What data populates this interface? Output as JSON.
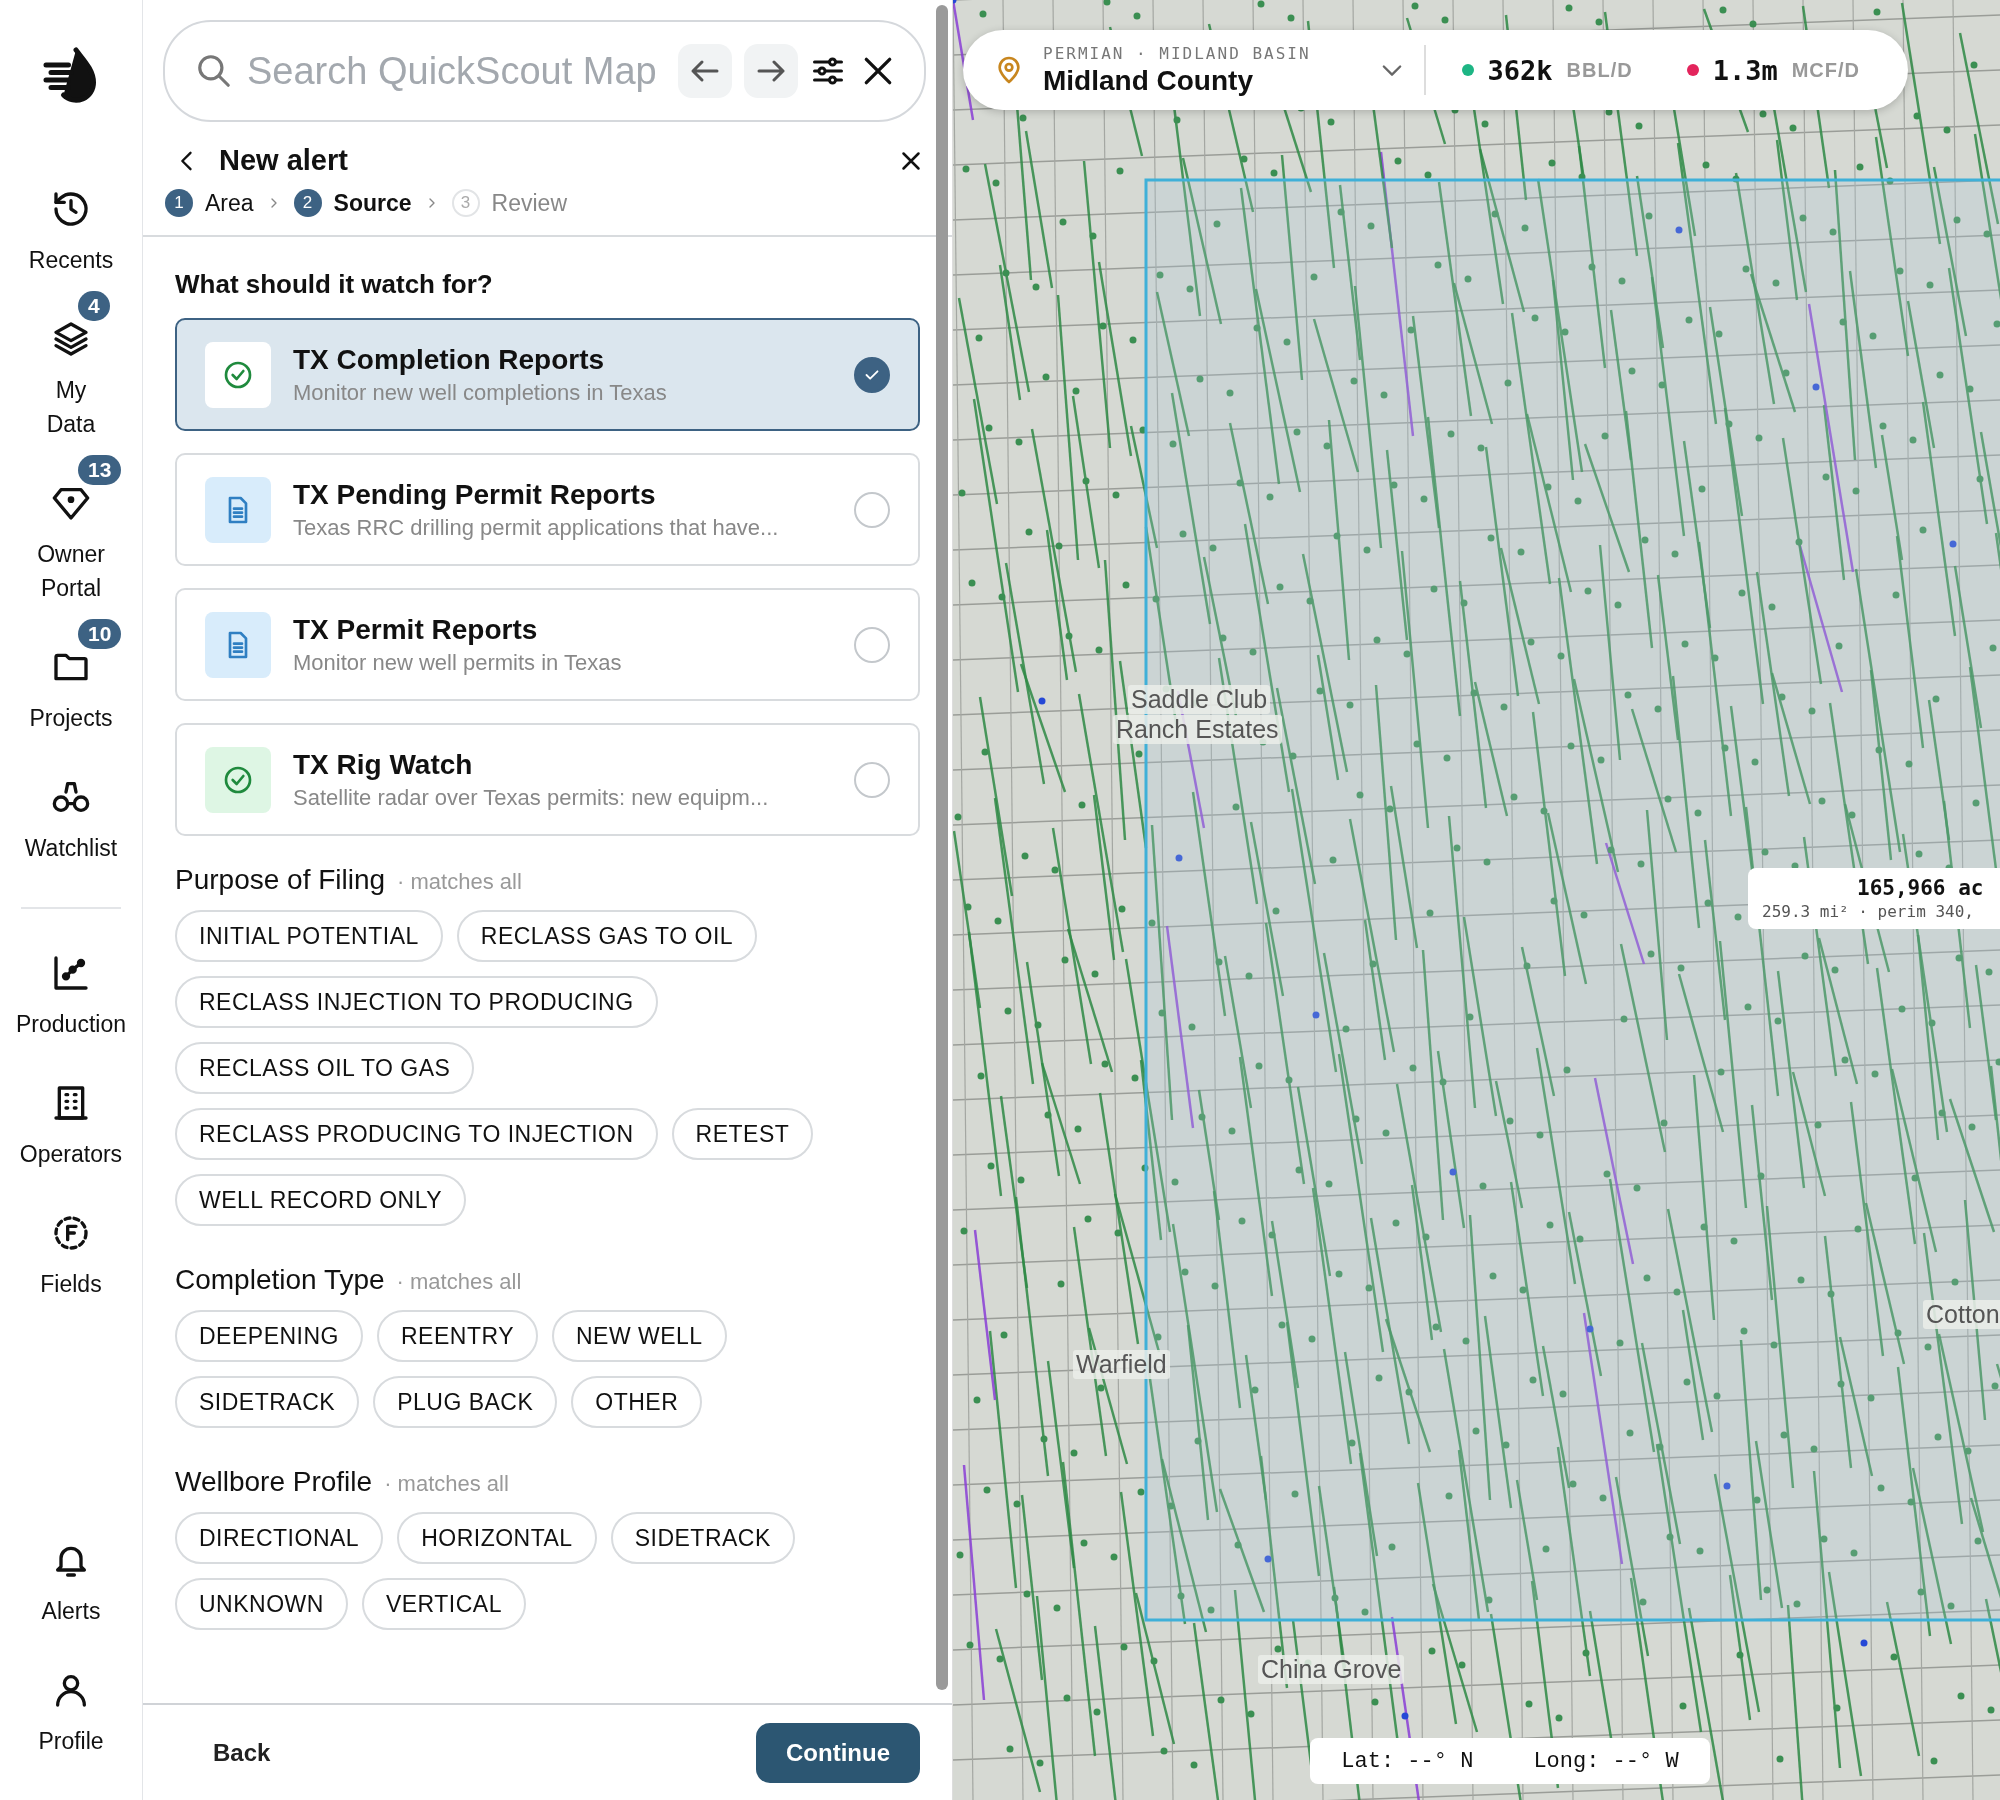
{
  "sidebar": {
    "primary": [
      {
        "label": "Recents"
      },
      {
        "label": "My Data",
        "badge": "4"
      },
      {
        "label": "Owner Portal",
        "badge": "13"
      },
      {
        "label": "Projects",
        "badge": "10"
      },
      {
        "label": "Watchlist"
      }
    ],
    "secondary": [
      {
        "label": "Production"
      },
      {
        "label": "Operators"
      },
      {
        "label": "Fields"
      }
    ],
    "bottom": [
      {
        "label": "Alerts"
      },
      {
        "label": "Profile"
      }
    ]
  },
  "search": {
    "placeholder": "Search QuickScout Map"
  },
  "alert": {
    "title": "New alert",
    "steps": [
      {
        "number": "1",
        "label": "Area",
        "disabled": false,
        "selected": false
      },
      {
        "number": "2",
        "label": "Source",
        "disabled": false,
        "selected": true
      },
      {
        "number": "3",
        "label": "Review",
        "disabled": true,
        "selected": false
      }
    ],
    "question": "What should it watch for?",
    "sources": [
      {
        "kind": "check",
        "title": "TX Completion Reports",
        "description": "Monitor new well completions in Texas",
        "selected": true
      },
      {
        "kind": "document",
        "title": "TX Pending Permit Reports",
        "description": "Texas RRC drilling permit applications that have...",
        "selected": false
      },
      {
        "kind": "document",
        "title": "TX Permit Reports",
        "description": "Monitor new well permits in Texas",
        "selected": false
      },
      {
        "kind": "check",
        "title": "TX Rig Watch",
        "description": "Satellite radar over Texas permits: new equipm...",
        "selected": false
      }
    ],
    "filters": [
      {
        "title": "Purpose of Filing",
        "note": "· matches all",
        "options": [
          "INITIAL POTENTIAL",
          "RECLASS GAS TO OIL",
          "RECLASS INJECTION TO PRODUCING",
          "RECLASS OIL TO GAS",
          "RECLASS PRODUCING TO INJECTION",
          "RETEST",
          "WELL RECORD ONLY"
        ]
      },
      {
        "title": "Completion Type",
        "note": "· matches all",
        "options": [
          "DEEPENING",
          "REENTRY",
          "NEW WELL",
          "SIDETRACK",
          "PLUG BACK",
          "OTHER"
        ]
      },
      {
        "title": "Wellbore Profile",
        "note": "· matches all",
        "options": [
          "DIRECTIONAL",
          "HORIZONTAL",
          "SIDETRACK",
          "UNKNOWN",
          "VERTICAL"
        ]
      }
    ],
    "back": "Back",
    "continue": "Continue"
  },
  "map": {
    "region": "PERMIAN · MIDLAND BASIN",
    "county": "Midland County",
    "stats": [
      {
        "value": "362k",
        "unit": "BBL/D",
        "color": "#1db584"
      },
      {
        "value": "1.3m",
        "unit": "MCF/D",
        "color": "#e3245c"
      }
    ],
    "area": {
      "acres": "165,966 ac",
      "detail": "259.3 mi² · perim 340,"
    },
    "places": [
      "Saddle Club",
      "Ranch Estates",
      "Warfield",
      "China Grove",
      "Cotton"
    ],
    "coords": [
      "Lat: --° N",
      "Long: --° W"
    ]
  }
}
